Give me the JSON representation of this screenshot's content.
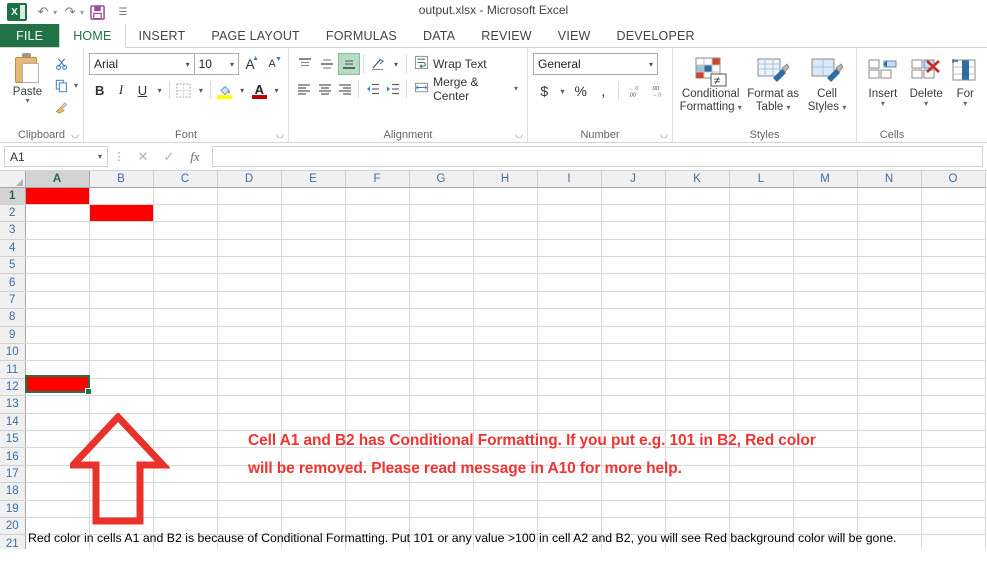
{
  "window": {
    "title": "output.xlsx - Microsoft Excel"
  },
  "quick_access": {
    "logo": "excel-logo-icon",
    "items": [
      {
        "name": "undo-icon",
        "glyph": "↶"
      },
      {
        "name": "redo-icon",
        "glyph": "↷"
      },
      {
        "name": "save-icon",
        "glyph": "Ὃe"
      },
      {
        "name": "customize-qat-icon",
        "glyph": "≡"
      }
    ]
  },
  "ribbon_tabs": [
    {
      "label": "FILE",
      "active": false,
      "file": true
    },
    {
      "label": "HOME",
      "active": true,
      "file": false
    },
    {
      "label": "INSERT",
      "active": false,
      "file": false
    },
    {
      "label": "PAGE LAYOUT",
      "active": false,
      "file": false
    },
    {
      "label": "FORMULAS",
      "active": false,
      "file": false
    },
    {
      "label": "DATA",
      "active": false,
      "file": false
    },
    {
      "label": "REVIEW",
      "active": false,
      "file": false
    },
    {
      "label": "VIEW",
      "active": false,
      "file": false
    },
    {
      "label": "DEVELOPER",
      "active": false,
      "file": false
    }
  ],
  "ribbon": {
    "clipboard": {
      "group_label": "Clipboard",
      "paste_label": "Paste",
      "cut_label": "Cut",
      "copy_label": "Copy",
      "format_painter_label": "Format Painter"
    },
    "font": {
      "group_label": "Font",
      "font_name": "Arial",
      "font_size": "10",
      "grow_label": "A",
      "shrink_label": "A",
      "bold": "B",
      "italic": "I",
      "underline": "U",
      "borders_label": "Borders",
      "fill_color_label": "Fill Color",
      "font_color_label": "Font Color",
      "fill_color": "#FFFF00",
      "font_color": "#C00000"
    },
    "alignment": {
      "group_label": "Alignment",
      "wrap_text_label": "Wrap Text",
      "merge_center_label": "Merge & Center",
      "top_align_label": "Top Align",
      "middle_align_label": "Middle Align",
      "bottom_align_label": "Bottom Align",
      "align_left_label": "Align Left",
      "align_center_label": "Center",
      "align_right_label": "Align Right",
      "orientation_label": "Orientation",
      "decrease_indent_label": "Decrease Indent",
      "increase_indent_label": "Increase Indent"
    },
    "number": {
      "group_label": "Number",
      "format": "General",
      "currency": "$",
      "percent": "%",
      "comma": ",",
      "increase_decimal": ".00",
      "decrease_decimal": ".00"
    },
    "styles": {
      "group_label": "Styles",
      "conditional_formatting": "Conditional\nFormatting",
      "conditional_formatting_l1": "Conditional",
      "conditional_formatting_l2": "Formatting",
      "format_as_table_l1": "Format as",
      "format_as_table_l2": "Table",
      "cell_styles_l1": "Cell",
      "cell_styles_l2": "Styles"
    },
    "cells": {
      "group_label": "Cells",
      "insert_label": "Insert",
      "delete_label": "Delete",
      "format_label": "For"
    }
  },
  "formula_bar": {
    "name_box": "A1",
    "cancel_icon": "✕",
    "confirm_icon": "✓",
    "function_icon": "fx",
    "formula_value": "",
    "formula_placeholder": ""
  },
  "grid": {
    "columns": [
      "A",
      "B",
      "C",
      "D",
      "E",
      "F",
      "G",
      "H",
      "I",
      "J",
      "K",
      "L",
      "M",
      "N",
      "O"
    ],
    "selected_column": "A",
    "rows": [
      1,
      2,
      3,
      4,
      5,
      6,
      7,
      8,
      9,
      10,
      11,
      12,
      13,
      14,
      15,
      16,
      17,
      18,
      19,
      20,
      21
    ],
    "selected_row": 1,
    "red_cells": [
      "A1",
      "B2"
    ],
    "red_fill_color": "#FF0000",
    "selection_color": "#217346",
    "cells": {
      "A10": "Red color in cells A1 and B2 is because of Conditional Formatting. Put 101 or any value >100 in cell A2 and B2, you will see Red background color will be gone."
    },
    "annotation": {
      "line1": "Cell A1 and B2 has Conditional Formatting. If you put e.g. 101 in B2, Red color",
      "line2": "will be removed. Please read message in A10 for more help.",
      "color": "#EF3434",
      "arrow_name": "up-arrow-shape",
      "arrow_color": "#E8322A"
    }
  }
}
